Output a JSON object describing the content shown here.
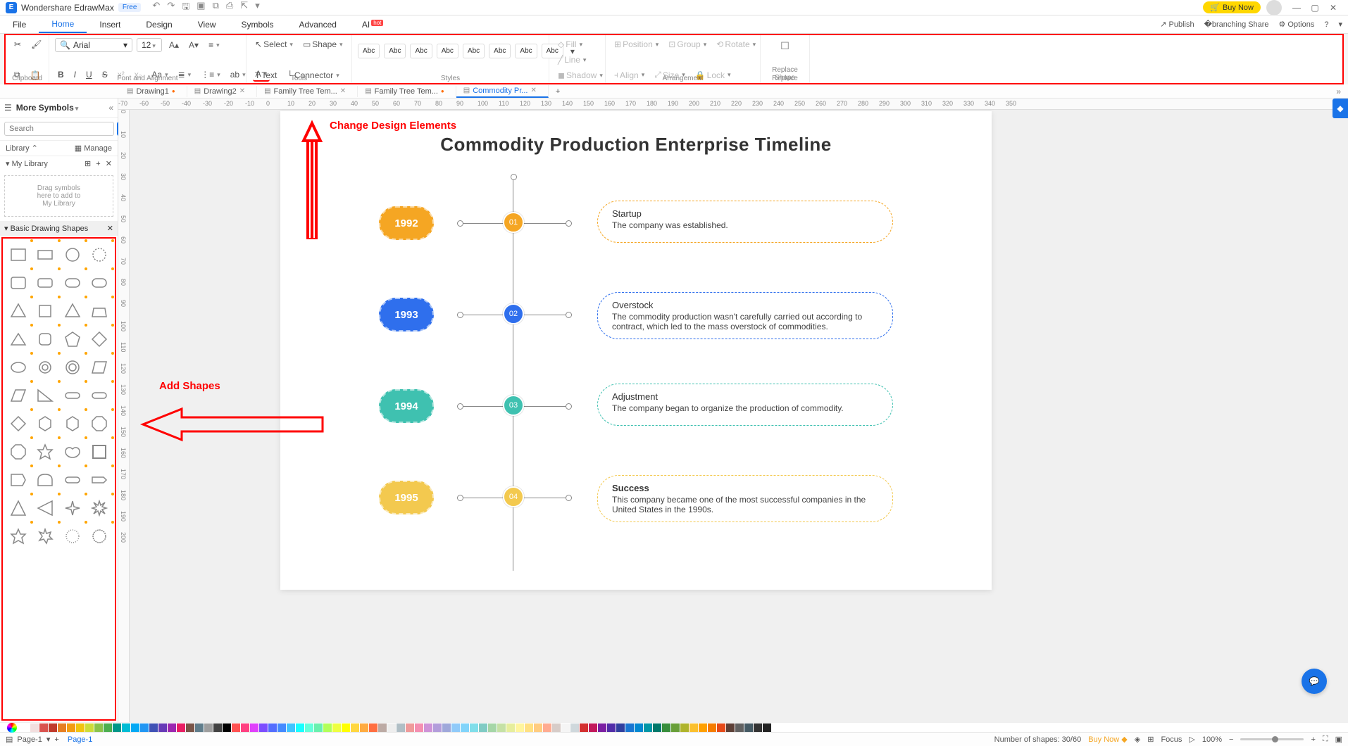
{
  "titlebar": {
    "app_name": "Wondershare EdrawMax",
    "free_badge": "Free",
    "buy_now": "Buy Now"
  },
  "menubar": {
    "items": [
      "File",
      "Home",
      "Insert",
      "Design",
      "View",
      "Symbols",
      "Advanced",
      "AI"
    ],
    "active_index": 1,
    "hot_label": "hot",
    "right": {
      "publish": "Publish",
      "share": "Share",
      "options": "Options"
    }
  },
  "ribbon": {
    "clipboard_label": "Clipboard",
    "font_label": "Font and Alignment",
    "tools_label": "Tools",
    "styles_label": "Styles",
    "arrangement_label": "Arrangement",
    "replace_label": "Replace",
    "font_name": "Arial",
    "font_size": "12",
    "select": "Select",
    "shape": "Shape",
    "text": "Text",
    "connector": "Connector",
    "style_cell": "Abc",
    "fill": "Fill",
    "line": "Line",
    "shadow": "Shadow",
    "position": "Position",
    "align": "Align",
    "group": "Group",
    "size": "Size",
    "rotate": "Rotate",
    "lock": "Lock",
    "replace_shape": "Replace\nShape"
  },
  "sidebar": {
    "more_symbols": "More Symbols",
    "search_btn": "Search",
    "search_placeholder": "Search",
    "library": "Library",
    "manage": "Manage",
    "my_library": "My Library",
    "drag_hint": "Drag symbols\nhere to add to\nMy Library",
    "basic_shapes": "Basic Drawing Shapes"
  },
  "tabs": [
    {
      "label": "Drawing1",
      "modified": true,
      "active": false
    },
    {
      "label": "Drawing2",
      "modified": false,
      "active": false,
      "closable": true
    },
    {
      "label": "Family Tree Tem...",
      "modified": false,
      "active": false,
      "closable": true
    },
    {
      "label": "Family Tree Tem...",
      "modified": true,
      "active": false
    },
    {
      "label": "Commodity Pr...",
      "modified": false,
      "active": true,
      "closable": true
    }
  ],
  "annotations": {
    "change_design": "Change Design Elements",
    "add_shapes": "Add Shapes"
  },
  "canvas": {
    "title": "Commodity Production Enterprise Timeline",
    "items": [
      {
        "year": "1992",
        "num": "01",
        "color": "#f5a623",
        "card_border": "#f5a623",
        "title": "Startup",
        "desc": "The company was established."
      },
      {
        "year": "1993",
        "num": "02",
        "color": "#2f6fed",
        "card_border": "#2f6fed",
        "title": "Overstock",
        "desc": "The commodity production wasn't carefully carried out according to contract, which led to the mass overstock of commodities."
      },
      {
        "year": "1994",
        "num": "03",
        "color": "#3fc1b0",
        "card_border": "#3fc1b0",
        "title": "Adjustment",
        "desc": "The company began to organize the production of commodity."
      },
      {
        "year": "1995",
        "num": "04",
        "color": "#f3c94f",
        "card_border": "#f3c94f",
        "title": "Success",
        "title_bold": true,
        "desc": "This company became one of the most successful companies in the United States in the 1990s."
      }
    ]
  },
  "ruler_h": [
    "-70",
    "-60",
    "-50",
    "-40",
    "-30",
    "-20",
    "-10",
    "0",
    "10",
    "20",
    "30",
    "40",
    "50",
    "60",
    "70",
    "80",
    "90",
    "100",
    "110",
    "120",
    "130",
    "140",
    "150",
    "160",
    "170",
    "180",
    "190",
    "200",
    "210",
    "220",
    "230",
    "240",
    "250",
    "260",
    "270",
    "280",
    "290",
    "300",
    "310",
    "320",
    "330",
    "340",
    "350"
  ],
  "ruler_v": [
    "0",
    "10",
    "20",
    "30",
    "40",
    "50",
    "60",
    "70",
    "80",
    "90",
    "100",
    "110",
    "120",
    "130",
    "140",
    "150",
    "160",
    "170",
    "180",
    "190",
    "200"
  ],
  "colors": [
    "#ffffff",
    "#f2dede",
    "#d9534f",
    "#c0392b",
    "#e67e22",
    "#f39c12",
    "#f1c40f",
    "#cddc39",
    "#8bc34a",
    "#4caf50",
    "#009688",
    "#00bcd4",
    "#03a9f4",
    "#2196f3",
    "#3f51b5",
    "#673ab7",
    "#9c27b0",
    "#e91e63",
    "#795548",
    "#607d8b",
    "#9e9e9e",
    "#424242",
    "#000000",
    "#ff5252",
    "#ff4081",
    "#e040fb",
    "#7c4dff",
    "#536dfe",
    "#448aff",
    "#40c4ff",
    "#18ffff",
    "#64ffda",
    "#69f0ae",
    "#b2ff59",
    "#eeff41",
    "#ffff00",
    "#ffd740",
    "#ffab40",
    "#ff6e40",
    "#bcaaa4",
    "#eeeeee",
    "#b0bec5",
    "#ef9a9a",
    "#f48fb1",
    "#ce93d8",
    "#b39ddb",
    "#9fa8da",
    "#90caf9",
    "#81d4fa",
    "#80deea",
    "#80cbc4",
    "#a5d6a7",
    "#c5e1a5",
    "#e6ee9c",
    "#fff59d",
    "#ffe082",
    "#ffcc80",
    "#ffab91",
    "#d7ccc8",
    "#f5f5f5",
    "#cfd8dc",
    "#d32f2f",
    "#c2185b",
    "#7b1fa2",
    "#512da8",
    "#303f9f",
    "#1976d2",
    "#0288d1",
    "#0097a7",
    "#00796b",
    "#388e3c",
    "#689f38",
    "#afb42b",
    "#fbc02d",
    "#ffa000",
    "#f57c00",
    "#e64a19",
    "#5d4037",
    "#616161",
    "#455a64",
    "#333333",
    "#222222"
  ],
  "statusbar": {
    "page_sel": "Page-1",
    "page_tab": "Page-1",
    "shapes_count": "Number of shapes: 30/60",
    "buy_now": "Buy Now",
    "focus": "Focus",
    "zoom": "100%"
  }
}
